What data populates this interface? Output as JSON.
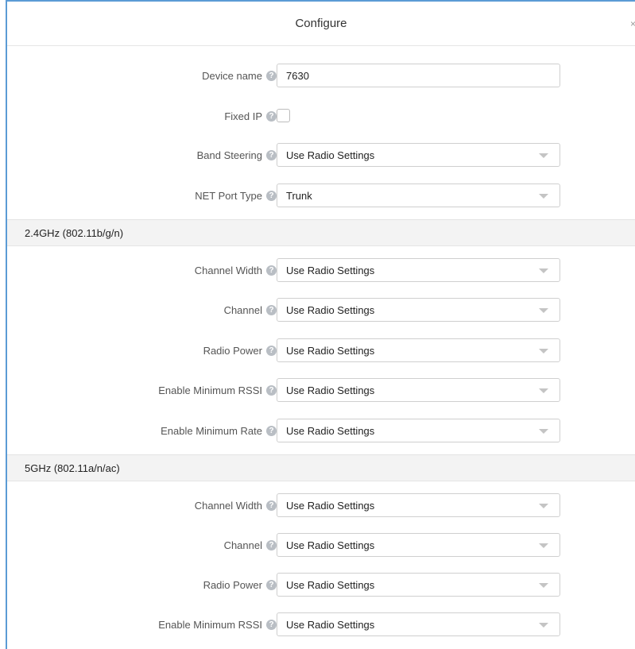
{
  "dialog": {
    "title": "Configure",
    "close_glyph": "×"
  },
  "general": {
    "device_name": {
      "label": "Device name",
      "value": "7630"
    },
    "fixed_ip": {
      "label": "Fixed IP",
      "checked": false
    },
    "band_steering": {
      "label": "Band Steering",
      "value": "Use Radio Settings"
    },
    "net_port_type": {
      "label": "NET Port Type",
      "value": "Trunk"
    }
  },
  "band_24": {
    "title": "2.4GHz (802.11b/g/n)",
    "channel_width": {
      "label": "Channel Width",
      "value": "Use Radio Settings"
    },
    "channel": {
      "label": "Channel",
      "value": "Use Radio Settings"
    },
    "radio_power": {
      "label": "Radio Power",
      "value": "Use Radio Settings"
    },
    "min_rssi": {
      "label": "Enable Minimum RSSI",
      "value": "Use Radio Settings"
    },
    "min_rate": {
      "label": "Enable Minimum Rate",
      "value": "Use Radio Settings"
    }
  },
  "band_5": {
    "title": "5GHz (802.11a/n/ac)",
    "channel_width": {
      "label": "Channel Width",
      "value": "Use Radio Settings"
    },
    "channel": {
      "label": "Channel",
      "value": "Use Radio Settings"
    },
    "radio_power": {
      "label": "Radio Power",
      "value": "Use Radio Settings"
    },
    "min_rssi": {
      "label": "Enable Minimum RSSI",
      "value": "Use Radio Settings"
    }
  },
  "icons": {
    "help": "?"
  }
}
